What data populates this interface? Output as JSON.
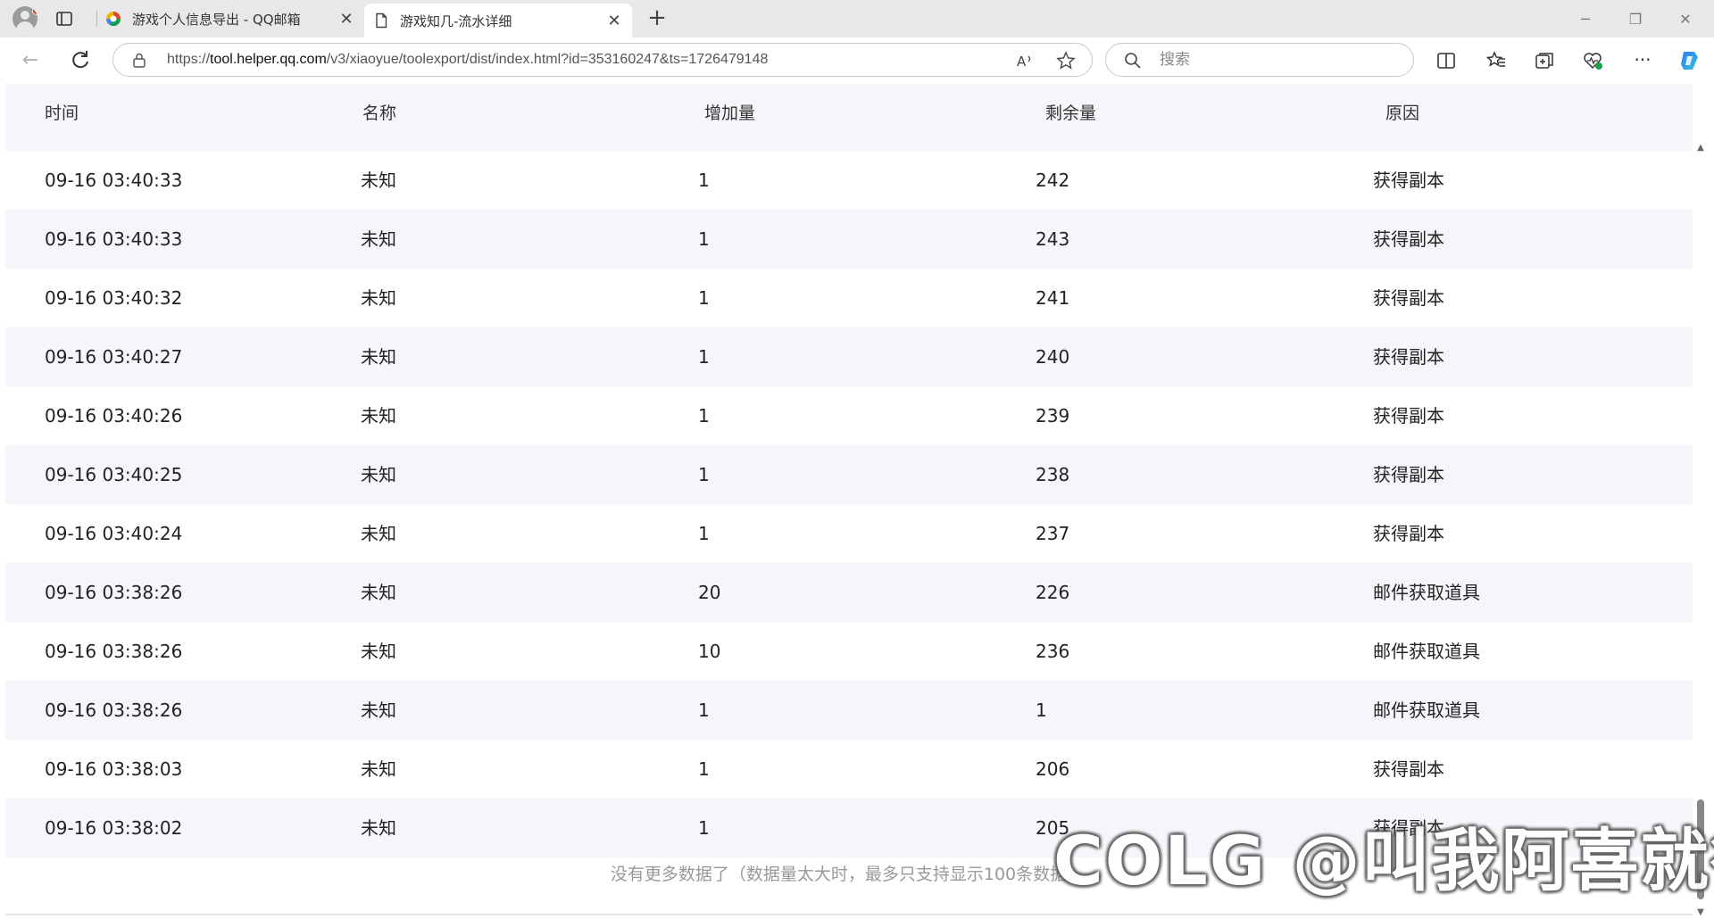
{
  "browser": {
    "tabs": [
      {
        "title": "游戏个人信息导出 - QQ邮箱",
        "active": false
      },
      {
        "title": "游戏知几-流水详细",
        "active": true
      }
    ],
    "url_prefix": "https://",
    "url_host": "tool.helper.qq.com",
    "url_path": "/v3/xiaoyue/toolexport/dist/index.html?id=353160247&ts=1726479148",
    "search_placeholder": "搜索"
  },
  "table": {
    "headers": [
      "时间",
      "名称",
      "增加量",
      "剩余量",
      "原因"
    ],
    "rows": [
      {
        "time": "09-16 03:40:33",
        "name": "未知",
        "increase": "1",
        "remaining": "242",
        "reason": "获得副本"
      },
      {
        "time": "09-16 03:40:33",
        "name": "未知",
        "increase": "1",
        "remaining": "243",
        "reason": "获得副本"
      },
      {
        "time": "09-16 03:40:32",
        "name": "未知",
        "increase": "1",
        "remaining": "241",
        "reason": "获得副本"
      },
      {
        "time": "09-16 03:40:27",
        "name": "未知",
        "increase": "1",
        "remaining": "240",
        "reason": "获得副本"
      },
      {
        "time": "09-16 03:40:26",
        "name": "未知",
        "increase": "1",
        "remaining": "239",
        "reason": "获得副本"
      },
      {
        "time": "09-16 03:40:25",
        "name": "未知",
        "increase": "1",
        "remaining": "238",
        "reason": "获得副本"
      },
      {
        "time": "09-16 03:40:24",
        "name": "未知",
        "increase": "1",
        "remaining": "237",
        "reason": "获得副本"
      },
      {
        "time": "09-16 03:38:26",
        "name": "未知",
        "increase": "20",
        "remaining": "226",
        "reason": "邮件获取道具"
      },
      {
        "time": "09-16 03:38:26",
        "name": "未知",
        "increase": "10",
        "remaining": "236",
        "reason": "邮件获取道具"
      },
      {
        "time": "09-16 03:38:26",
        "name": "未知",
        "increase": "1",
        "remaining": "1",
        "reason": "邮件获取道具"
      },
      {
        "time": "09-16 03:38:03",
        "name": "未知",
        "increase": "1",
        "remaining": "206",
        "reason": "获得副本"
      },
      {
        "time": "09-16 03:38:02",
        "name": "未知",
        "increase": "1",
        "remaining": "205",
        "reason": "获得副本"
      }
    ],
    "footer": "没有更多数据了（数据量太大时，最多只支持显示100条数据）"
  },
  "watermark": "COLG @叫我阿喜就行",
  "colors": {
    "row_alt": "#f5f6fa",
    "header_bg": "#f5f6fa",
    "footer_text": "#999999"
  }
}
